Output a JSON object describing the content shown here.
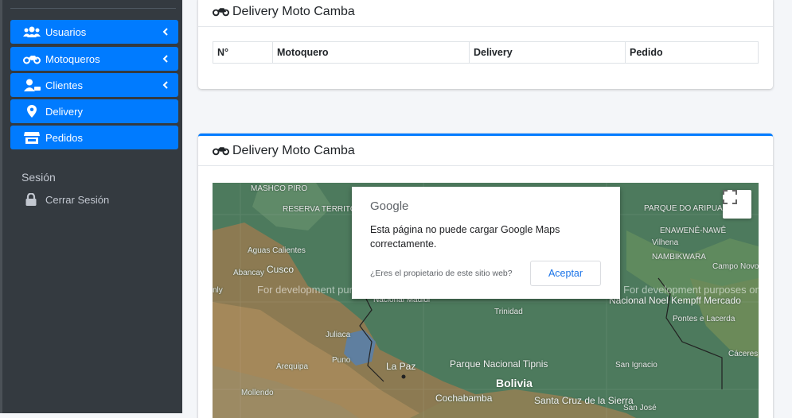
{
  "sidebar": {
    "items": [
      {
        "label": "Usuarios",
        "icon": "users-icon",
        "has_chevron": true
      },
      {
        "label": "Motoqueros",
        "icon": "motorcycle-icon",
        "has_chevron": true
      },
      {
        "label": "Clientes",
        "icon": "user-tie-icon",
        "has_chevron": true
      },
      {
        "label": "Delivery",
        "icon": "map-marker-icon",
        "has_chevron": false
      },
      {
        "label": "Pedidos",
        "icon": "store-icon",
        "has_chevron": false
      }
    ],
    "session_header": "Sesión",
    "logout_label": "Cerrar Sesión"
  },
  "top_card": {
    "title": "Delivery Moto Camba",
    "table_headers": [
      "N°",
      "Motoquero",
      "Delivery",
      "Pedido"
    ]
  },
  "map_card": {
    "title": "Delivery Moto Camba",
    "dev_watermark": "For development purposes only",
    "dialog": {
      "logo": "Google",
      "message": "Esta página no puede cargar Google Maps correctamente.",
      "owner_question": "¿Eres el propietario de este sitio web?",
      "accept_button": "Aceptar"
    },
    "labels": {
      "mashco": "MASHCO PIRO",
      "reserva": "RESERVA TERRITORIAL MADRE DE DIOS",
      "aguas": "Aguas Calientes",
      "abancay": "Abancay",
      "cusco": "Cusco",
      "madidi": "Nacional Madidi",
      "juliaca": "Juliaca",
      "puno": "Puno",
      "arequipa": "Arequipa",
      "lapaz": "La Paz",
      "tipnis": "Parque Nacional Tipnis",
      "bolivia": "Bolivia",
      "cochabamba": "Cochabamba",
      "santacruz": "Santa Cruz de la Sierra",
      "mollendo": "Mollendo",
      "trinidad": "Trinidad",
      "parque_aripuana": "PARQUE DO ARIPUANÃ",
      "enawene": "ENAWENÊ-NAWÊ",
      "vilhena": "Vilhena",
      "nambikwara": "NAMBIKWARA",
      "campo_novo": "Campo Novo do Parecis",
      "noel": "Nacional Noel Kempff Mercado",
      "pontes": "Pontes e Lacerda",
      "caceres": "Cáceres",
      "san_ignacio": "San Ignacio",
      "san_jose": "San José",
      "nly": "nly"
    }
  },
  "colors": {
    "accent": "#007bff",
    "sidebar_bg": "#343a40",
    "map_green": "#4d7a5d",
    "map_tan": "#a4885a",
    "lake": "#5f7fa0"
  }
}
